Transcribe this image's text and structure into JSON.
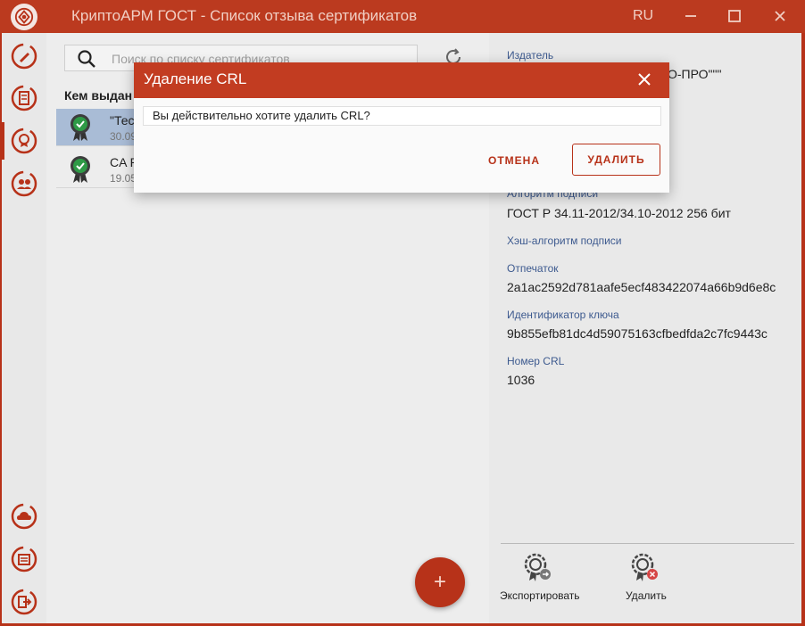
{
  "window": {
    "title": "КриптоАРМ ГОСТ - Список отзыва сертификатов",
    "language": "RU"
  },
  "icons": {
    "app_logo": "app-logo-icon",
    "minimize": "minimize-icon",
    "maximize": "maximize-icon",
    "close": "close-icon",
    "search": "search-icon",
    "refresh": "refresh-icon",
    "certificate": "certificate-valid-icon"
  },
  "sidebar": {
    "items": [
      {
        "name": "sign-icon"
      },
      {
        "name": "documents-icon"
      },
      {
        "name": "certificates-icon",
        "active": true
      },
      {
        "name": "contacts-icon"
      },
      {
        "name": "cloud-icon"
      },
      {
        "name": "events-icon"
      },
      {
        "name": "exit-icon"
      }
    ]
  },
  "list": {
    "search_placeholder": "Поиск по списку сертификатов",
    "column_header": "Кем выдан",
    "rows": [
      {
        "name": "\"Тес",
        "date": "30.09"
      },
      {
        "name": "CA P",
        "date": "19.05"
      }
    ],
    "fab_label": "+"
  },
  "details": {
    "issuer_label": "Издатель",
    "issuer_value": "О-ПРО\"\"\"",
    "sign_alg_label": "Алгоритм подписи",
    "sign_alg_value": "ГОСТ Р 34.11-2012/34.10-2012 256 бит",
    "hash_alg_label": "Хэш-алгоритм подписи",
    "thumbprint_label": "Отпечаток",
    "thumbprint_value": "2a1ac2592d781aafe5ecf483422074a66b9d6e8c",
    "key_id_label": "Идентификатор ключа",
    "key_id_value": "9b855efb81dc4d59075163cfbedfda2c7fc9443c",
    "crl_number_label": "Номер CRL",
    "crl_number_value": "1036",
    "actions": [
      {
        "label": "Экспортировать"
      },
      {
        "label": "Удалить"
      }
    ]
  },
  "dialog": {
    "title": "Удаление CRL",
    "message": "Вы действительно хотите удалить CRL?",
    "cancel": "ОТМЕНА",
    "confirm": "УДАЛИТЬ"
  },
  "colors": {
    "brand": "#b73219",
    "label": "#3d5a8f",
    "selection": "#a9bcd6"
  }
}
